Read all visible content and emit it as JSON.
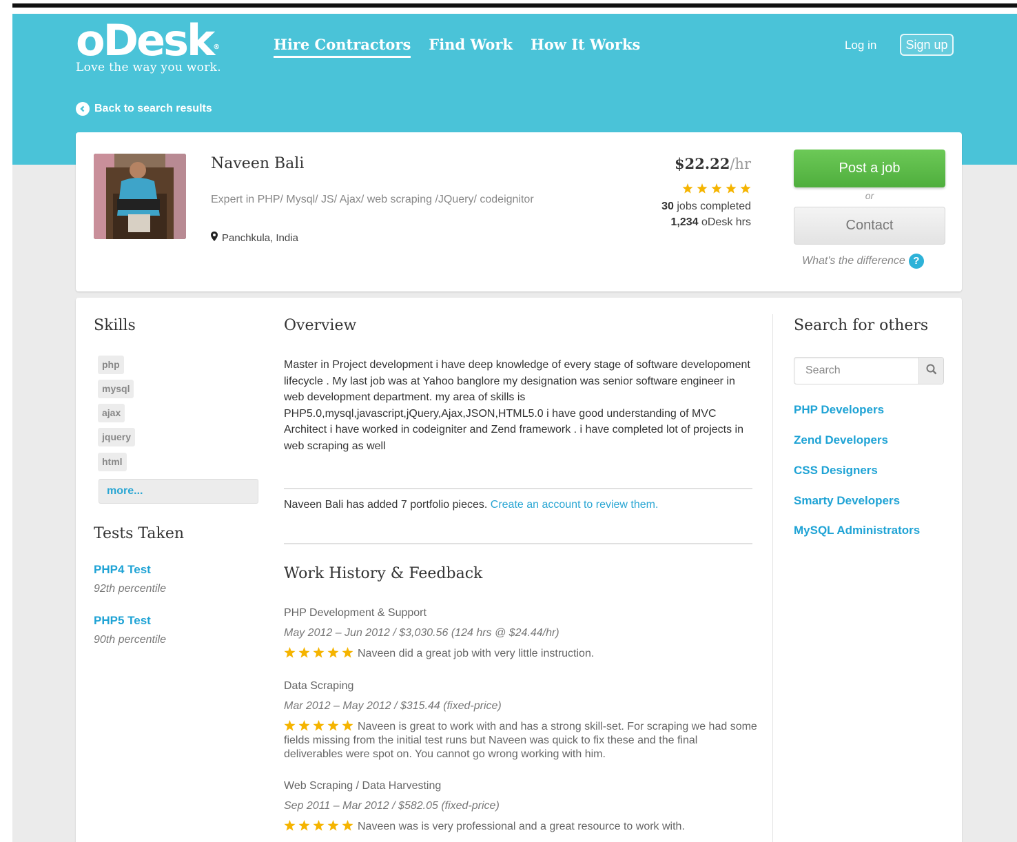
{
  "header": {
    "logo": "oDesk",
    "tagline": "Love the way you work.",
    "nav": [
      "Hire Contractors",
      "Find Work",
      "How It Works"
    ],
    "login": "Log in",
    "signup": "Sign up",
    "back": "Back to search results"
  },
  "profile": {
    "name": "Naveen Bali",
    "title": "Expert in PHP/ Mysql/ JS/ Ajax/ web scraping /JQuery/ codeignitor",
    "location": "Panchkula, India",
    "rate": "$22.22",
    "rate_unit": "/hr",
    "rating": 5,
    "jobs_count": "30",
    "jobs_label": "jobs completed",
    "hours_count": "1,234",
    "hours_label": "oDesk hrs",
    "post_job": "Post a job",
    "or": "or",
    "contact": "Contact",
    "difference": "What's the difference",
    "help_glyph": "?"
  },
  "skills": {
    "title": "Skills",
    "items": [
      "php",
      "mysql",
      "ajax",
      "jquery",
      "html"
    ],
    "more": "more..."
  },
  "tests": {
    "title": "Tests Taken",
    "items": [
      {
        "name": "PHP4 Test",
        "score": "92th percentile"
      },
      {
        "name": "PHP5 Test",
        "score": "90th percentile"
      }
    ]
  },
  "overview": {
    "title": "Overview",
    "text": "Master in Project development i have deep knowledge of every stage of software developoment lifecycle . My last job was at Yahoo banglore my designation was senior software engineer in web development department. my area of skills is PHP5.0,mysql,javascript,jQuery,Ajax,JSON,HTML5.0 i have good understanding of MVC Architect i have worked in codeigniter and Zend framework . i have completed lot of projects in web scraping as well",
    "portfolio_text": "Naveen Bali has added 7 portfolio pieces.",
    "portfolio_link": "Create an account to review them."
  },
  "work_history": {
    "title": "Work History & Feedback",
    "jobs": [
      {
        "title": "PHP Development & Support",
        "meta": "May 2012 – Jun 2012 / $3,030.56  (124 hrs @ $24.44/hr)",
        "rating": 5,
        "feedback": "Naveen did a great job with very little instruction."
      },
      {
        "title": "Data Scraping",
        "meta": "Mar 2012 – May 2012 / $315.44 (fixed-price)",
        "rating": 5,
        "feedback": "Naveen is great to work with and has a strong skill-set. For scraping we had some fields missing from the initial test runs but Naveen was quick to fix these and the final deliverables were spot on. You cannot go wrong working with him."
      },
      {
        "title": "Web Scraping / Data Harvesting",
        "meta": "Sep 2011 – Mar 2012 / $582.05 (fixed-price)",
        "rating": 5,
        "feedback": "Naveen was is very professional and a great resource to work with."
      }
    ]
  },
  "search_others": {
    "title": "Search for others",
    "placeholder": "Search",
    "links": [
      "PHP Developers",
      "Zend Developers",
      "CSS Designers",
      "Smarty Developers",
      "MySQL Administrators"
    ]
  },
  "colors": {
    "header": "#4ac3d8",
    "link": "#1fa3d5",
    "star": "#f5b400",
    "post_button": "#5bbb47"
  }
}
